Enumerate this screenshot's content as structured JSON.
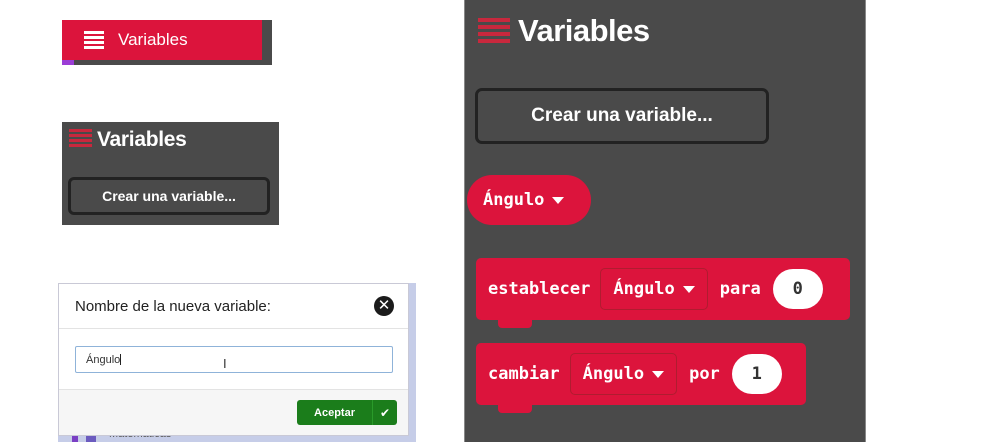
{
  "colors": {
    "block_red": "#dc143c",
    "panel_bg": "#4a4a4a",
    "ok_green": "#1b7d1b"
  },
  "category_tab": {
    "label": "Variables",
    "icon": "list-icon"
  },
  "small_flyout": {
    "title": "Variables",
    "create_button": "Crear una variable..."
  },
  "dialog": {
    "title": "Nombre de la nueva variable:",
    "close_icon": "close-circle-icon",
    "input_value": "Ángulo",
    "ok_button": "Aceptar",
    "ok_icon": "check-icon",
    "peek_text": "Matemáticas"
  },
  "big_flyout": {
    "title": "Variables",
    "create_button": "Crear una variable...",
    "variable_block": {
      "name": "Ángulo"
    },
    "set_block": {
      "keyword": "establecer",
      "variable": "Ángulo",
      "connector": "para",
      "value": "0"
    },
    "change_block": {
      "keyword": "cambiar",
      "variable": "Ángulo",
      "connector": "por",
      "value": "1"
    }
  }
}
